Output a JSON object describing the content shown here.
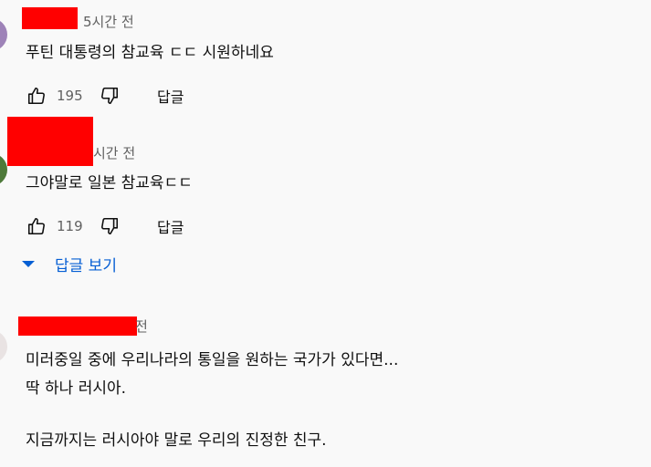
{
  "comments": [
    {
      "time": "5시간 전",
      "text": "푸틴 대통령의 참교육 ㄷㄷ 시원하네요",
      "likes": "195",
      "reply_label": "답글",
      "avatar_color": "#9e83b8"
    },
    {
      "time": "시간 전",
      "text": "그야말로 일본 참교육ㄷㄷ",
      "likes": "119",
      "reply_label": "답글",
      "avatar_color": "#4e7a3a"
    },
    {
      "time": "전",
      "line1": "미러중일 중에 우리나라의 통일을 원하는 국가가 있다면...",
      "line2": "딱 하나 러시아.",
      "line3": "지금까지는 러시아야 말로 우리의 진정한 친구.",
      "avatar_color": "#e9e3e3"
    }
  ],
  "view_replies_label": "답글 보기",
  "colors": {
    "redaction": "#ff0000",
    "link": "#065fd4",
    "meta": "#606060"
  },
  "icons": [
    "like-icon",
    "dislike-icon",
    "caret-down-icon"
  ]
}
